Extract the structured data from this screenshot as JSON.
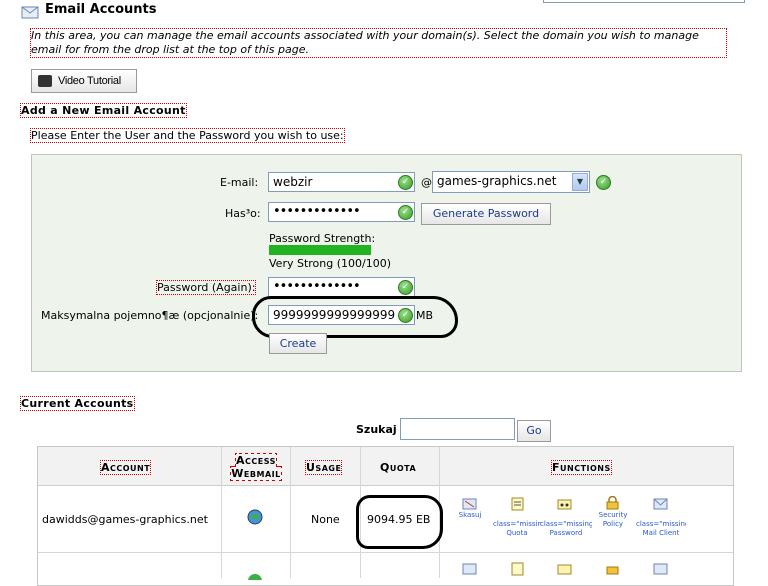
{
  "header": {
    "title": "Email Accounts"
  },
  "intro": "In this area, you can manage the email accounts associated with your domain(s). Select the domain you wish to manage email for from the drop list at the top of this page.",
  "video_button": "Video Tutorial",
  "add_section": {
    "title": "Add a New Email Account",
    "subtitle": "Please Enter the User and the Password you wish to use:",
    "email_label": "E-mail:",
    "email_value": "webzir",
    "at": "@",
    "domain_value": "games-graphics.net",
    "password_label": "Has³o:",
    "password_value": "•••••••••••••",
    "generate_button": "Generate Password",
    "strength_label": "Password Strength:",
    "strength_value": "Very Strong (100/100)",
    "strength_fraction": 1.0,
    "password_again_label": "Password (Again):",
    "password_again_value": "•••••••••••••",
    "quota_label": "Maksymalna pojemno¶æ (opcjonalnie):",
    "quota_value": "9999999999999999",
    "quota_unit": "MB",
    "create_button": "Create"
  },
  "current": {
    "title": "Current Accounts",
    "search_label": "Szukaj",
    "go_button": "Go",
    "columns": [
      "Account",
      "Access Webmail",
      "Usage",
      "Quota",
      "Functions"
    ],
    "row": {
      "account": "dawidds@games-graphics.net",
      "usage": "None",
      "quota": "9094.95 EB"
    },
    "functions": {
      "delete": "Skasuj",
      "quota": "class=\"missinglangkey\">Change Quota",
      "password": "class=\"missinglangkey\">Change Password",
      "security": "Security Policy",
      "configure": "class=\"missinglangkey\">Configure Mail Client"
    }
  }
}
